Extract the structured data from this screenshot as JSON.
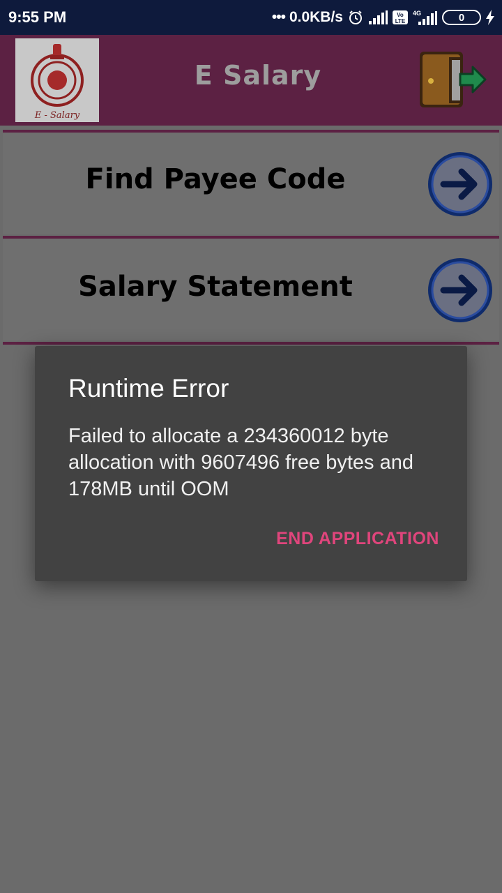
{
  "status_bar": {
    "time": "9:55 PM",
    "network_speed": "0.0KB/s",
    "network_indicator": "•••",
    "battery_level": "0",
    "network_type": "4G",
    "volte_badge": "Vo LTE",
    "icons": [
      "alarm-icon",
      "signal-icon",
      "volte-icon",
      "signal-4g-icon",
      "battery-icon",
      "charging-icon"
    ]
  },
  "app_bar": {
    "title": "E Salary",
    "logo_caption": "E - Salary",
    "colors": {
      "background": "#5c2143",
      "title": "#9d9d9d"
    }
  },
  "menu": {
    "items": [
      {
        "label": "Find Payee Code",
        "icon": "arrow-right-icon"
      },
      {
        "label": "Salary Statement",
        "icon": "arrow-right-icon"
      }
    ]
  },
  "dialog": {
    "title": "Runtime Error",
    "message": "Failed to allocate a 234360012 byte allocation with 9607496 free bytes and 178MB until OOM",
    "button_label": "END APPLICATION",
    "colors": {
      "background": "#424242",
      "button": "#e0457c"
    }
  }
}
